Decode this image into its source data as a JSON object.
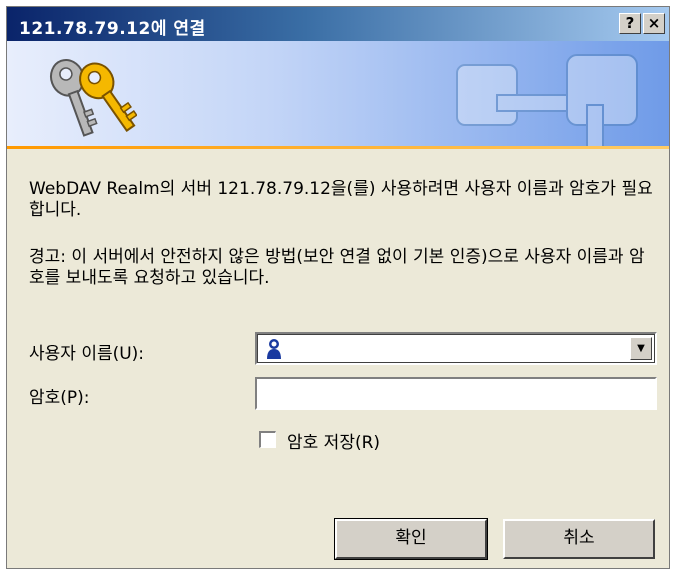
{
  "titlebar": {
    "title": "121.78.79.12에 연결",
    "help_label": "?",
    "close_label": "×"
  },
  "banner": {
    "icon": "keys-icon"
  },
  "message": {
    "line1": "WebDAV Realm의 서버 121.78.79.12을(를) 사용하려면 사용자 이름과 암호가 필요합니다.",
    "line2": "경고: 이 서버에서 안전하지 않은 방법(보안 연결 없이 기본 인증)으로 사용자 이름과 암호를 보내도록 요청하고 있습니다."
  },
  "form": {
    "username_label": "사용자 이름(U):",
    "username_value": "",
    "password_label": "암호(P):",
    "password_value": "",
    "save_password_label": "암호 저장(R)",
    "save_password_checked": false
  },
  "buttons": {
    "ok": "확인",
    "cancel": "취소"
  },
  "colors": {
    "titlebar_start": "#0a246a",
    "dialog_bg": "#ece9d8",
    "banner_accent": "#ff9900"
  }
}
